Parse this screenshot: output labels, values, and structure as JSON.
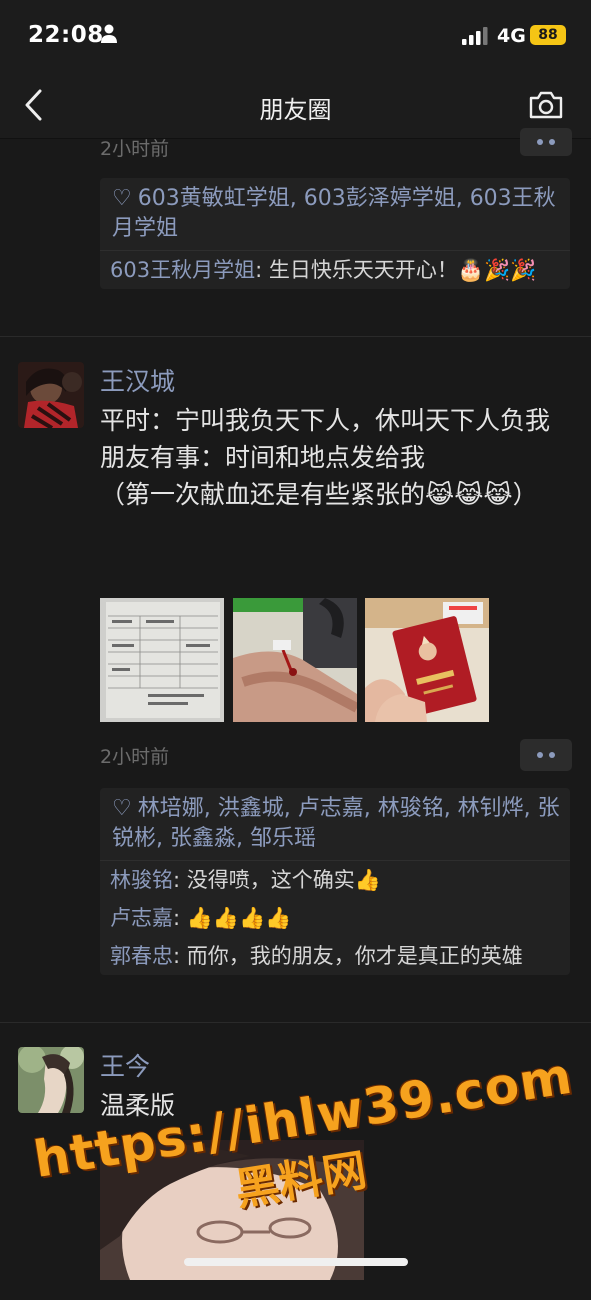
{
  "status_bar": {
    "time": "22:08",
    "network": "4G",
    "battery": "88"
  },
  "nav": {
    "title": "朋友圈"
  },
  "top_post": {
    "time": "2小时前",
    "likes": "603黄敏虹学姐, 603彭泽婷学姐, 603王秋月学姐",
    "comments": [
      {
        "author": "603王秋月学姐",
        "sep": ": ",
        "text": "生日快乐天天开心！🎂🎉🎉"
      }
    ]
  },
  "post1": {
    "author": "王汉城",
    "lines": [
      "平时：宁叫我负天下人，休叫天下人负我",
      "朋友有事：时间和地点发给我",
      "（第一次献血还是有些紧张的😹😹😹）"
    ],
    "time": "2小时前",
    "likes": "林培娜, 洪鑫城, 卢志嘉, 林骏铭, 林钊烨, 张锐彬, 张鑫淼, 邹乐瑶",
    "comments": [
      {
        "author": "林骏铭",
        "sep": ": ",
        "text": "没得喷，这个确实👍"
      },
      {
        "author": "卢志嘉",
        "sep": ": ",
        "text": "👍👍👍👍"
      },
      {
        "author": "郭春忠",
        "sep": ": ",
        "text": "而你，我的朋友，你才是真正的英雄"
      }
    ]
  },
  "post2": {
    "author": "王今",
    "text": "温柔版"
  },
  "watermark": {
    "url": "https://ihlw39.com",
    "name": "黑料网"
  }
}
